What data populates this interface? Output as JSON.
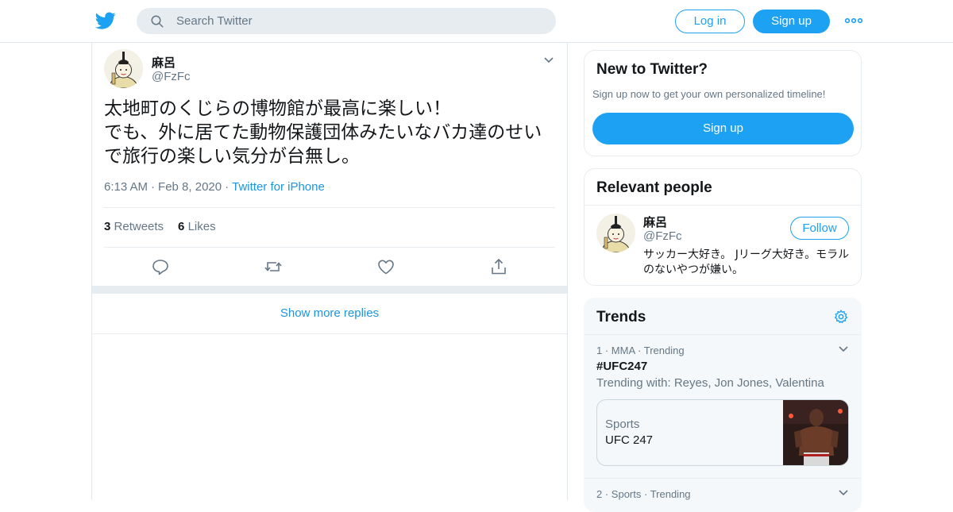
{
  "header": {
    "search_placeholder": "Search Twitter",
    "login_label": "Log in",
    "signup_label": "Sign up",
    "brand_color": "#1da1f2"
  },
  "tweet": {
    "name": "麻呂",
    "handle": "@FzFc",
    "text": "太地町のくじらの博物館が最高に楽しい！\nでも、外に居てた動物保護団体みたいなバカ達のせい\nで旅行の楽しい気分が台無し。",
    "time": "6:13 AM",
    "date": "Feb 8, 2020",
    "source": "Twitter for iPhone",
    "retweets_count": "3",
    "retweets_label": "Retweets",
    "likes_count": "6",
    "likes_label": "Likes",
    "show_more_label": "Show more replies"
  },
  "sidebar": {
    "new_to_twitter": {
      "title": "New to Twitter?",
      "subtitle": "Sign up now to get your own personalized timeline!",
      "button_label": "Sign up"
    },
    "relevant_people": {
      "title": "Relevant people",
      "name": "麻呂",
      "handle": "@FzFc",
      "follow_label": "Follow",
      "bio": "サッカー大好き。 Jリーグ大好き。モラルのないやつが嫌い。"
    },
    "trends": {
      "title": "Trends",
      "items": [
        {
          "rank": "1",
          "category": "MMA",
          "status": "Trending",
          "tag": "#UFC247",
          "trending_with": "Trending with: Reyes, Jon Jones, Valentina",
          "card_category": "Sports",
          "card_title": "UFC 247"
        },
        {
          "rank": "2",
          "category": "Sports",
          "status": "Trending"
        }
      ]
    }
  }
}
